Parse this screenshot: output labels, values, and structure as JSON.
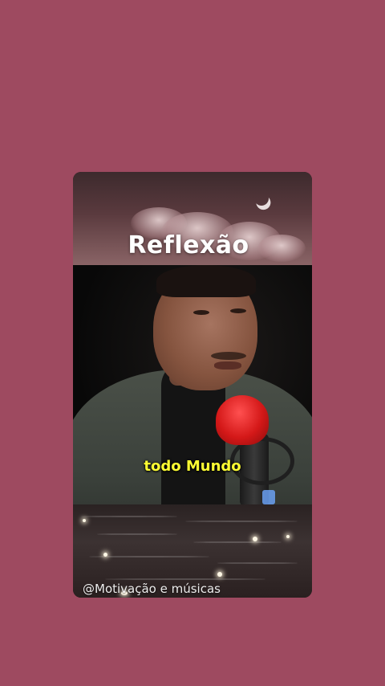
{
  "video": {
    "title": "Reflexão",
    "caption": "todo Mundo",
    "watermark": "@Motivação e músicas"
  },
  "colors": {
    "background": "#9e4a60",
    "title": "#ffffff",
    "caption": "#ffff33",
    "microphone": "#d41818"
  }
}
